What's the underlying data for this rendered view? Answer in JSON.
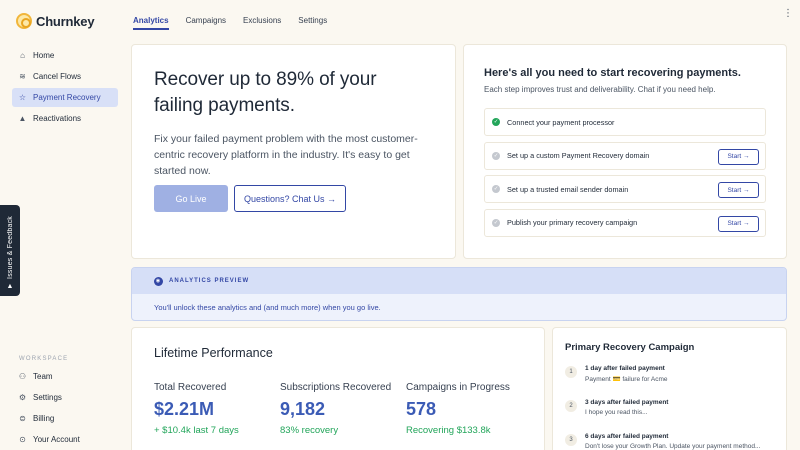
{
  "app": {
    "name": "Churnkey"
  },
  "sidebar": {
    "items": [
      {
        "label": "Home",
        "icon": "home-icon",
        "glyph": "⌂"
      },
      {
        "label": "Cancel Flows",
        "icon": "wifi-icon",
        "glyph": "≋"
      },
      {
        "label": "Payment Recovery",
        "icon": "star-icon",
        "glyph": "☆"
      },
      {
        "label": "Reactivations",
        "icon": "mountain-icon",
        "glyph": "▲"
      }
    ],
    "workspace_label": "WORKSPACE",
    "workspace_items": [
      {
        "label": "Team",
        "icon": "team-icon",
        "glyph": "⚇"
      },
      {
        "label": "Settings",
        "icon": "gear-icon",
        "glyph": "⚙"
      },
      {
        "label": "Billing",
        "icon": "billing-icon",
        "glyph": "⊜"
      },
      {
        "label": "Your Account",
        "icon": "account-icon",
        "glyph": "⊙"
      }
    ]
  },
  "feedback_tab": {
    "label": "Issues & Feedback",
    "glyph": "▲"
  },
  "tabs": [
    {
      "label": "Analytics",
      "active": true
    },
    {
      "label": "Campaigns",
      "active": false
    },
    {
      "label": "Exclusions",
      "active": false
    },
    {
      "label": "Settings",
      "active": false
    }
  ],
  "hero": {
    "title": "Recover up to 89% of your failing payments.",
    "body": "Fix your failed payment problem with the most customer-centric recovery platform in the industry. It's easy to get started now.",
    "primary_button": "Go Live",
    "secondary_button": "Questions? Chat Us →"
  },
  "steps_card": {
    "title": "Here's all you need to start recovering payments.",
    "subtitle": "Each step improves trust and deliverability. Chat if you need help.",
    "start_label": "Start →",
    "steps": [
      {
        "label": "Connect your payment processor",
        "done": true
      },
      {
        "label": "Set up a custom Payment Recovery domain",
        "done": false
      },
      {
        "label": "Set up a trusted email sender domain",
        "done": false
      },
      {
        "label": "Publish your primary recovery campaign",
        "done": false
      }
    ]
  },
  "preview": {
    "label": "ANALYTICS PREVIEW",
    "message": "You'll unlock these analytics and (and much more) when you go live."
  },
  "lifetime": {
    "title": "Lifetime Performance",
    "metrics": [
      {
        "label": "Total Recovered",
        "value": "$2.21M",
        "sub": "+ $10.4k last 7 days"
      },
      {
        "label": "Subscriptions Recovered",
        "value": "9,182",
        "sub": "83% recovery"
      },
      {
        "label": "Campaigns in Progress",
        "value": "578",
        "sub": "Recovering $133.8k"
      }
    ]
  },
  "campaign": {
    "title": "Primary Recovery Campaign",
    "items": [
      {
        "num": "1",
        "title": "1 day after failed payment",
        "desc": "Payment 💳 failure for Acme"
      },
      {
        "num": "2",
        "title": "3 days after failed payment",
        "desc": "I hope you read this..."
      },
      {
        "num": "3",
        "title": "6 days after failed payment",
        "desc": "Don't lose your Growth Plan. Update your payment method..."
      }
    ]
  },
  "colors": {
    "accent": "#3347a5",
    "success": "#22a55a",
    "background": "#fbf8f1"
  }
}
